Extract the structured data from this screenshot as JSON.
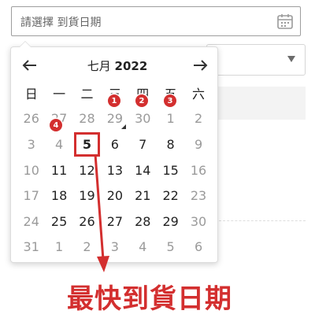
{
  "date_input": {
    "placeholder": "請選擇 到貨日期",
    "icon": "calendar-icon"
  },
  "calendar": {
    "month_label": "七月",
    "year_label": "2022",
    "weekdays": [
      "日",
      "一",
      "二",
      "三",
      "四",
      "五",
      "六"
    ],
    "weeks": [
      [
        {
          "d": "26",
          "m": true
        },
        {
          "d": "27",
          "m": true
        },
        {
          "d": "28",
          "m": true
        },
        {
          "d": "29",
          "m": true
        },
        {
          "d": "30",
          "m": true
        },
        {
          "d": "1",
          "m": true
        },
        {
          "d": "2",
          "m": true
        }
      ],
      [
        {
          "d": "3",
          "m": true
        },
        {
          "d": "4",
          "m": true
        },
        {
          "d": "5",
          "m": false,
          "sel": true
        },
        {
          "d": "6",
          "m": false
        },
        {
          "d": "7",
          "m": false
        },
        {
          "d": "8",
          "m": false
        },
        {
          "d": "9",
          "m": true
        }
      ],
      [
        {
          "d": "10",
          "m": true
        },
        {
          "d": "11",
          "m": false
        },
        {
          "d": "12",
          "m": false
        },
        {
          "d": "13",
          "m": false
        },
        {
          "d": "14",
          "m": false
        },
        {
          "d": "15",
          "m": false
        },
        {
          "d": "16",
          "m": true
        }
      ],
      [
        {
          "d": "17",
          "m": true
        },
        {
          "d": "18",
          "m": false
        },
        {
          "d": "19",
          "m": false
        },
        {
          "d": "20",
          "m": false
        },
        {
          "d": "21",
          "m": false
        },
        {
          "d": "22",
          "m": false
        },
        {
          "d": "23",
          "m": true
        }
      ],
      [
        {
          "d": "24",
          "m": true
        },
        {
          "d": "25",
          "m": false
        },
        {
          "d": "26",
          "m": false
        },
        {
          "d": "27",
          "m": false
        },
        {
          "d": "28",
          "m": false
        },
        {
          "d": "29",
          "m": false
        },
        {
          "d": "30",
          "m": true
        }
      ],
      [
        {
          "d": "31",
          "m": true
        },
        {
          "d": "1",
          "m": true
        },
        {
          "d": "2",
          "m": true
        },
        {
          "d": "3",
          "m": true
        },
        {
          "d": "4",
          "m": true
        },
        {
          "d": "5",
          "m": true
        },
        {
          "d": "6",
          "m": true
        }
      ]
    ]
  },
  "badges": [
    "1",
    "2",
    "3",
    "4"
  ],
  "annotation": {
    "caption": "最快到貨日期",
    "color": "#d32f2f"
  }
}
